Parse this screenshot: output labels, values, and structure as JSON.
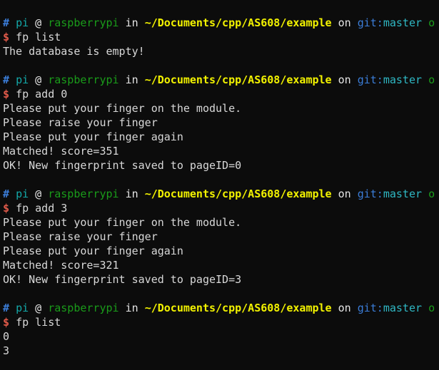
{
  "terminal": {
    "background": "#0c0c0c",
    "foreground": "#d8d8d8",
    "colors": {
      "hash": "#3b7dd8",
      "user": "#13a8a8",
      "host": "#1a9c1a",
      "path": "#f2f200",
      "git_key": "#3b7dd8",
      "branch": "#2fb8c4",
      "status_ok": "#1a9c1a",
      "prompt_symbol": "#e05a4a",
      "output": "#d8d8d8"
    },
    "prompt": {
      "hash": "#",
      "user": "pi",
      "at": "@",
      "host": "raspberrypi",
      "in_word": "in",
      "path": "~/Documents/cpp/AS608/example",
      "on_word": "on",
      "git_key": "git:",
      "branch": "master",
      "status": "o",
      "symbol": "$"
    },
    "blocks": [
      {
        "command": "fp list",
        "output": [
          "The database is empty!"
        ]
      },
      {
        "command": "fp add 0",
        "output": [
          "Please put your finger on the module.",
          "Please raise your finger",
          "Please put your finger again",
          "Matched! score=351",
          "OK! New fingerprint saved to pageID=0"
        ]
      },
      {
        "command": "fp add 3",
        "output": [
          "Please put your finger on the module.",
          "Please raise your finger",
          "Please put your finger again",
          "Matched! score=321",
          "OK! New fingerprint saved to pageID=3"
        ]
      },
      {
        "command": "fp list",
        "output": [
          "0",
          "3"
        ]
      }
    ]
  }
}
